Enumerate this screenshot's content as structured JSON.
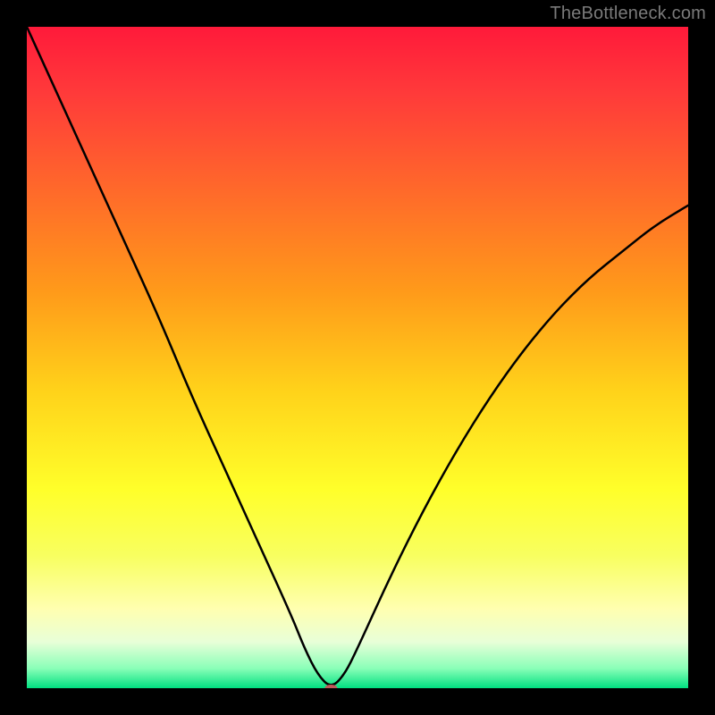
{
  "watermark": "TheBottleneck.com",
  "chart_data": {
    "type": "line",
    "title": "",
    "xlabel": "",
    "ylabel": "",
    "xlim": [
      0,
      100
    ],
    "ylim": [
      0,
      100
    ],
    "x": [
      0,
      5,
      10,
      15,
      20,
      25,
      30,
      35,
      40,
      42,
      44,
      46,
      48,
      50,
      55,
      60,
      65,
      70,
      75,
      80,
      85,
      90,
      95,
      100
    ],
    "y": [
      100,
      89,
      78,
      67,
      56,
      44,
      33,
      22,
      11,
      6,
      2,
      0,
      2,
      6,
      17,
      27,
      36,
      44,
      51,
      57,
      62,
      66,
      70,
      73
    ],
    "optimum_x": 46,
    "marker": {
      "x": 46,
      "y": 0,
      "color": "#c05a5a",
      "rx": 7,
      "ry": 4
    },
    "gradient_stops": [
      {
        "offset": 0.0,
        "color": "#ff1a3a"
      },
      {
        "offset": 0.1,
        "color": "#ff3a3a"
      },
      {
        "offset": 0.25,
        "color": "#ff6a2a"
      },
      {
        "offset": 0.4,
        "color": "#ff9a1a"
      },
      {
        "offset": 0.55,
        "color": "#ffd21a"
      },
      {
        "offset": 0.7,
        "color": "#ffff2a"
      },
      {
        "offset": 0.8,
        "color": "#f8ff60"
      },
      {
        "offset": 0.88,
        "color": "#ffffb0"
      },
      {
        "offset": 0.93,
        "color": "#e8ffd8"
      },
      {
        "offset": 0.97,
        "color": "#8affb8"
      },
      {
        "offset": 1.0,
        "color": "#00e080"
      }
    ],
    "curve_stroke": "#000000",
    "curve_width": 2.5
  }
}
